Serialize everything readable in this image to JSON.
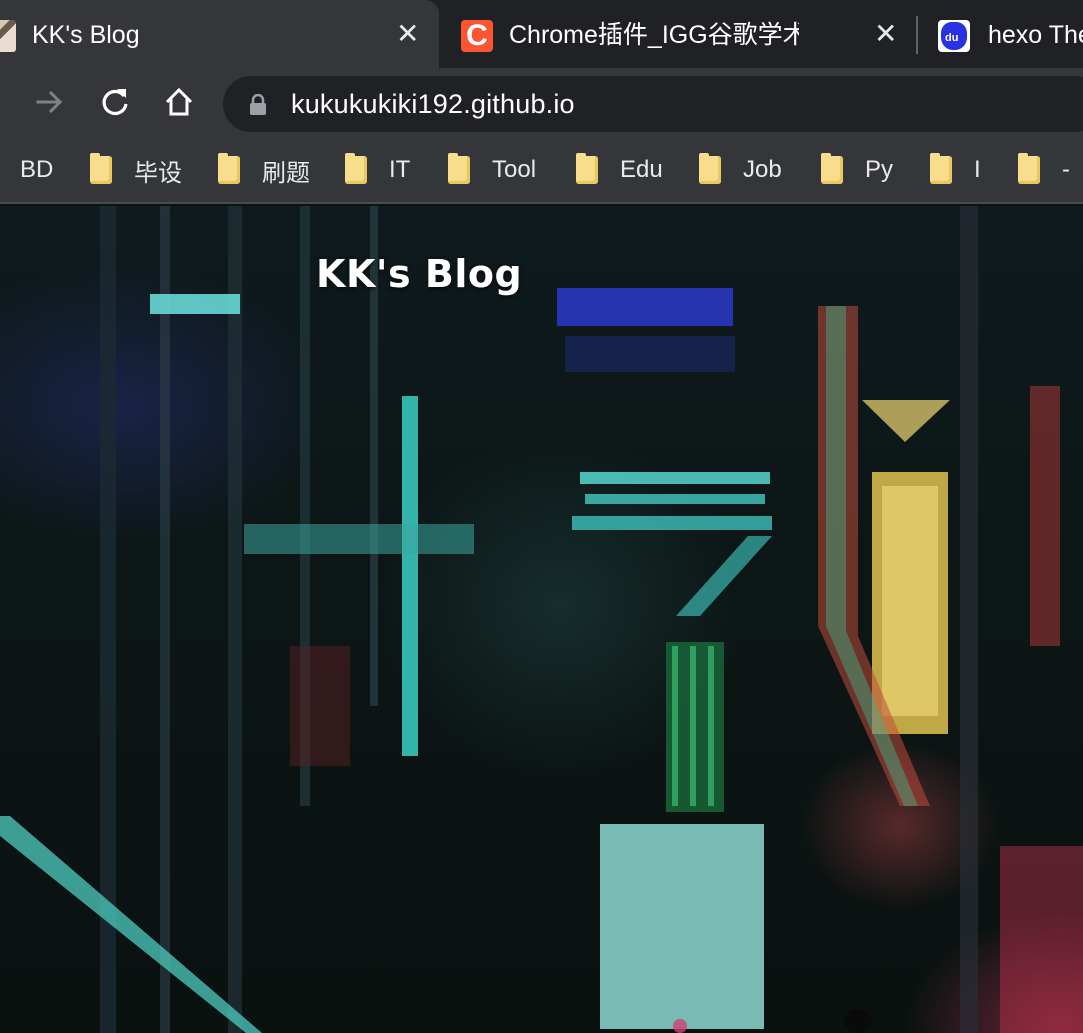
{
  "tabs": [
    {
      "title": "KK's Blog",
      "icon": "comic-favicon-icon",
      "active": true
    },
    {
      "title": "Chrome插件_IGG谷歌学术助手_",
      "icon": "csdn-c-icon",
      "active": false
    },
    {
      "title": "hexo The",
      "icon": "baidu-paw-icon",
      "active": false
    }
  ],
  "toolbar": {
    "url": "kukukukiki192.github.io"
  },
  "bookmarks": [
    {
      "label": "BD",
      "folder": false
    },
    {
      "label": "毕设",
      "folder": true
    },
    {
      "label": "刷题",
      "folder": true
    },
    {
      "label": "IT",
      "folder": true
    },
    {
      "label": "Tool",
      "folder": true
    },
    {
      "label": "Edu",
      "folder": true
    },
    {
      "label": "Job",
      "folder": true
    },
    {
      "label": "Py",
      "folder": true
    },
    {
      "label": "I",
      "folder": true
    },
    {
      "label": "-",
      "folder": true
    }
  ],
  "page": {
    "site_title": "KK's Blog"
  },
  "colors": {
    "tab_strip": "#202124",
    "active_tab": "#35363a",
    "omnibox": "#202124",
    "folder": "#f7dd8c"
  }
}
